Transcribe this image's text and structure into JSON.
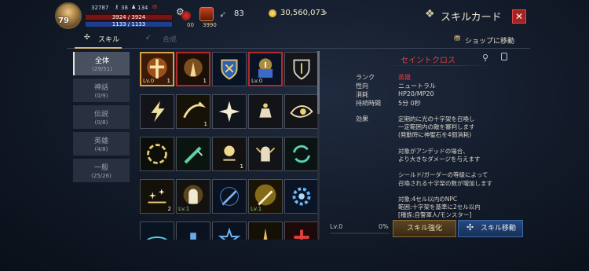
{
  "hud": {
    "level": "79",
    "stat_a": "32787",
    "stat_b": "38",
    "stat_c": "134",
    "hp": "3924 / 3924",
    "mp": "1133 / 1133",
    "item_count_1": "00",
    "item_count_2": "3990",
    "wings": "83",
    "gold": "30,560,073"
  },
  "title": "スキルカード",
  "close_label": "✕",
  "tabs": {
    "skill": "スキル",
    "synth": "合成"
  },
  "shop_link": "ショップに移動",
  "categories": [
    {
      "name": "全体",
      "count": "(29/51)"
    },
    {
      "name": "神話",
      "count": "(0/9)"
    },
    {
      "name": "伝説",
      "count": "(0/8)"
    },
    {
      "name": "英雄",
      "count": "(4/8)"
    },
    {
      "name": "一般",
      "count": "(25/26)"
    }
  ],
  "grid": [
    {
      "icon": "holy-cross-icon",
      "lv": "Lv.0",
      "count": "1"
    },
    {
      "icon": "praying-hands-icon",
      "lv": "",
      "count": "1"
    },
    {
      "icon": "shield-emblem-icon",
      "lv": "",
      "count": ""
    },
    {
      "icon": "holy-book-icon",
      "lv": "Lv.0",
      "count": ""
    },
    {
      "icon": "defense-shield-icon",
      "lv": "",
      "count": ""
    },
    {
      "icon": "lightning-strike-icon",
      "lv": "",
      "count": ""
    },
    {
      "icon": "swoosh-arrow-icon",
      "lv": "",
      "count": "1"
    },
    {
      "icon": "star-burst-icon",
      "lv": "",
      "count": ""
    },
    {
      "icon": "bell-altar-icon",
      "lv": "",
      "count": ""
    },
    {
      "icon": "evil-eye-icon",
      "lv": "",
      "count": ""
    },
    {
      "icon": "flame-spiral-icon",
      "lv": "",
      "count": ""
    },
    {
      "icon": "green-blade-icon",
      "lv": "",
      "count": ""
    },
    {
      "icon": "golden-orb-icon",
      "lv": "",
      "count": "1"
    },
    {
      "icon": "winged-helm-icon",
      "lv": "",
      "count": ""
    },
    {
      "icon": "green-cycle-icon",
      "lv": "",
      "count": ""
    },
    {
      "icon": "sparkle-ground-icon",
      "lv": "",
      "count": "2"
    },
    {
      "icon": "knight-helm-icon",
      "lv": "Lv.1",
      "count": ""
    },
    {
      "icon": "blue-sword-icon",
      "lv": "",
      "count": ""
    },
    {
      "icon": "radiant-sword-icon",
      "lv": "Lv.1",
      "count": ""
    },
    {
      "icon": "blue-gear-icon",
      "lv": "",
      "count": ""
    },
    {
      "icon": "cyan-vortex-icon",
      "lv": "",
      "count": ""
    },
    {
      "icon": "blue-pillar-icon",
      "lv": "",
      "count": ""
    },
    {
      "icon": "blue-star-icon",
      "lv": "",
      "count": ""
    },
    {
      "icon": "gold-spire-icon",
      "lv": "",
      "count": ""
    },
    {
      "icon": "red-cross-icon",
      "lv": "",
      "count": ""
    }
  ],
  "detail": {
    "name": "セイントクロス",
    "props": [
      {
        "label": "ランク",
        "value": "英雄",
        "red": true
      },
      {
        "label": "性向",
        "value": "ニュートラル",
        "red": false
      },
      {
        "label": "消耗",
        "value": "HP20/MP20",
        "red": false
      },
      {
        "label": "持続時間",
        "value": "5分 0秒",
        "red": false
      }
    ],
    "effect_label": "効果",
    "effect_lines": [
      "定期的に光の十字架を召喚し",
      "一定範囲内の敵を審判します",
      "(発動時に神聖石を4個消耗)",
      "",
      "対象がアンデッドの場合、",
      "より大きなダメージを与えます",
      "",
      "シールド/ガーダーの等級によって",
      "召喚される十字架の数が増加します",
      "",
      "対象:4セル以内のNPC",
      "範囲:十字架を基準に2セル以内",
      "[種族:自警軍人/モンスター]"
    ]
  },
  "bottom": {
    "level": "Lv.0",
    "percent": "0%",
    "progress": 0,
    "enhance_label": "スキル強化",
    "move_label": "スキル移動"
  }
}
